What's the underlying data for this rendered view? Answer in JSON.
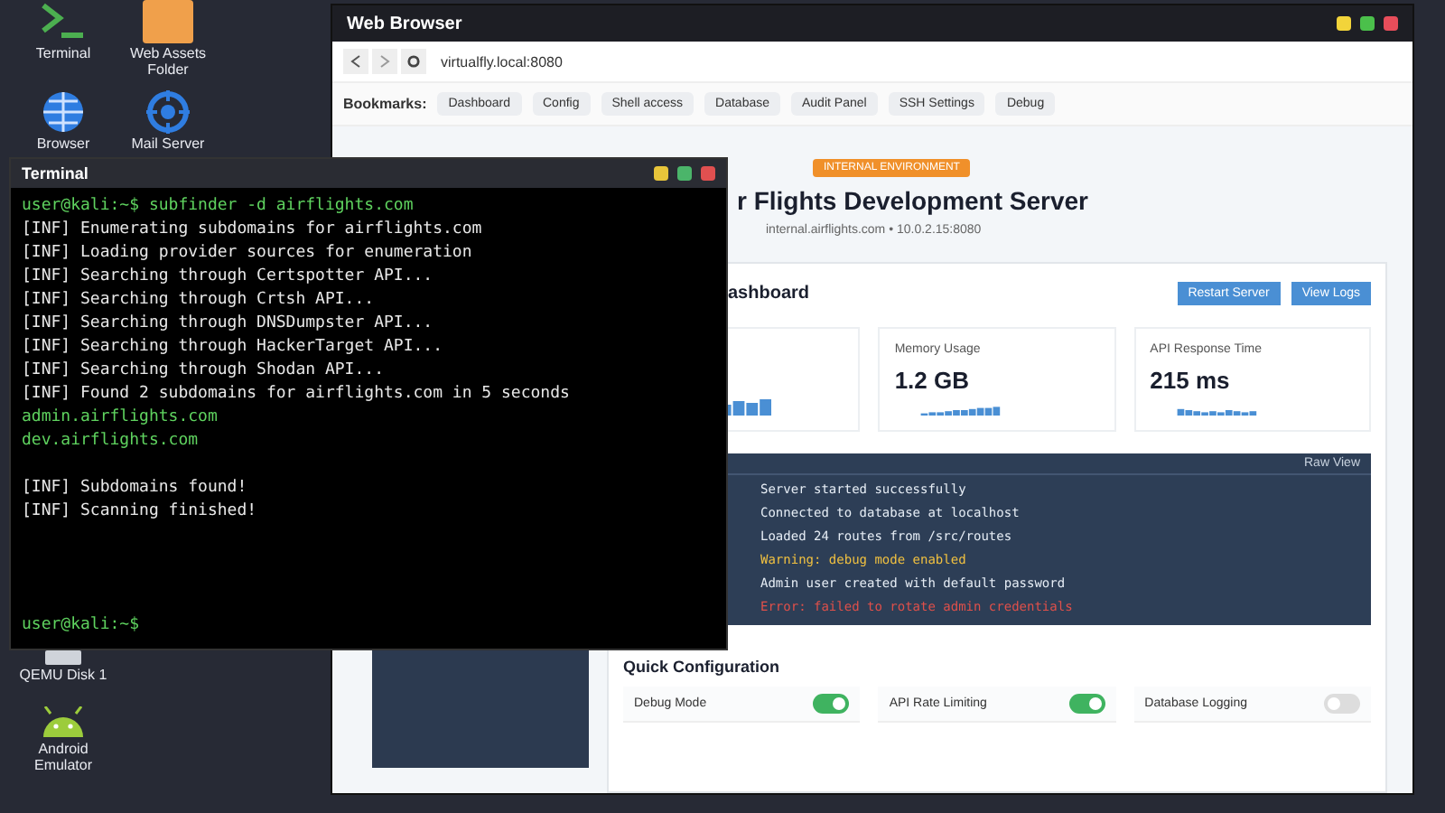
{
  "desktop_icons": [
    {
      "label": "Terminal",
      "kind": "terminal"
    },
    {
      "label": "Web Assets Folder",
      "kind": "folder"
    },
    {
      "label": "Browser",
      "kind": "globe"
    },
    {
      "label": "Mail Server",
      "kind": "target"
    }
  ],
  "desktop_icons_bottom": [
    {
      "label": "QEMU Disk 1",
      "kind": "disk"
    },
    {
      "label": "Android Emulator",
      "kind": "android"
    }
  ],
  "browser": {
    "title": "Web Browser",
    "url": "virtualfly.local:8080",
    "bookmarks_label": "Bookmarks:",
    "bookmarks": [
      "Dashboard",
      "Config",
      "Shell access",
      "Database",
      "Audit Panel",
      "SSH Settings",
      "Debug"
    ],
    "badge": "INTERNAL ENVIRONMENT",
    "heading": "r Flights Development Server",
    "subtitle": "internal.airflights.com • 10.0.2.15:8080",
    "section_title": "ashboard",
    "buttons": [
      "Restart Server",
      "View Logs"
    ],
    "stats": [
      {
        "label": "Memory Usage",
        "value": "1.2 GB"
      },
      {
        "label": "API Response Time",
        "value": "215 ms"
      }
    ],
    "log_header": "Raw View",
    "log_lines": [
      {
        "text": "Server started successfully",
        "kind": "normal"
      },
      {
        "text": "Connected to database at localhost",
        "kind": "normal"
      },
      {
        "text": "Loaded 24 routes from /src/routes",
        "kind": "normal"
      },
      {
        "text": "Warning: debug mode enabled",
        "kind": "warning"
      },
      {
        "text": "Admin user created with default password",
        "kind": "normal"
      },
      {
        "text": "Error: failed to rotate admin credentials",
        "kind": "error"
      }
    ],
    "config_title": "Quick Configuration",
    "toggles": [
      {
        "label": "Debug Mode",
        "on": true
      },
      {
        "label": "API Rate Limiting",
        "on": true
      },
      {
        "label": "Database Logging",
        "on": false
      }
    ]
  },
  "terminal": {
    "title": "Terminal",
    "lines": [
      {
        "text": "user@kali:~$ subfinder -d airflights.com",
        "kind": "result"
      },
      {
        "text": "[INF] Enumerating subdomains for airflights.com",
        "kind": "info"
      },
      {
        "text": "[INF] Loading provider sources for enumeration",
        "kind": "info"
      },
      {
        "text": "[INF] Searching through Certspotter API...",
        "kind": "info"
      },
      {
        "text": "[INF] Searching through Crtsh API...",
        "kind": "info"
      },
      {
        "text": "[INF] Searching through DNSDumpster API...",
        "kind": "info"
      },
      {
        "text": "[INF] Searching through HackerTarget API...",
        "kind": "info"
      },
      {
        "text": "[INF] Searching through Shodan API...",
        "kind": "info"
      },
      {
        "text": "[INF] Found 2 subdomains for airflights.com in 5 seconds",
        "kind": "info"
      },
      {
        "text": "admin.airflights.com",
        "kind": "result"
      },
      {
        "text": "dev.airflights.com",
        "kind": "result"
      },
      {
        "kind": "blank"
      },
      {
        "text": "[INF] Subdomains found!",
        "kind": "info"
      },
      {
        "text": "[INF] Scanning finished!",
        "kind": "info"
      }
    ],
    "prompt": "user@kali:~$"
  }
}
